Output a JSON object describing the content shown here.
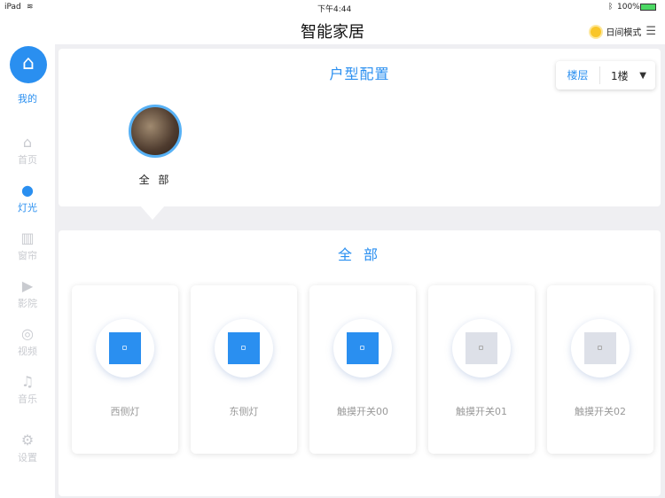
{
  "status_bar": {
    "device": "iPad",
    "time": "下午4:44",
    "battery": "100%"
  },
  "header": {
    "title": "智能家居",
    "mode": "日间模式"
  },
  "sidebar": {
    "profile": "我的",
    "items": [
      {
        "label": "首页",
        "icon": "home-icon",
        "glyph": "⌂",
        "active": false
      },
      {
        "label": "灯光",
        "icon": "lightbulb-icon",
        "glyph": "●",
        "active": true
      },
      {
        "label": "窗帘",
        "icon": "curtain-icon",
        "glyph": "▥",
        "active": false
      },
      {
        "label": "影院",
        "icon": "film-icon",
        "glyph": "▶",
        "active": false
      },
      {
        "label": "视频",
        "icon": "camera-icon",
        "glyph": "◎",
        "active": false
      },
      {
        "label": "音乐",
        "icon": "music-icon",
        "glyph": "♫",
        "active": false
      },
      {
        "label": "设置",
        "icon": "gear-icon",
        "glyph": "⚙",
        "active": false
      }
    ]
  },
  "layout_config": {
    "title": "户型配置",
    "floor_label": "楼层",
    "floor_value": "1楼",
    "rooms": [
      {
        "name": "全 部"
      }
    ]
  },
  "devices": {
    "title": "全 部",
    "items": [
      {
        "name": "西侧灯",
        "on": true
      },
      {
        "name": "东侧灯",
        "on": true
      },
      {
        "name": "触摸开关00",
        "on": true
      },
      {
        "name": "触摸开关01",
        "on": false
      },
      {
        "name": "触摸开关02",
        "on": false
      }
    ]
  },
  "colors": {
    "accent": "#2a8ff0",
    "off": "#dde0e8"
  }
}
